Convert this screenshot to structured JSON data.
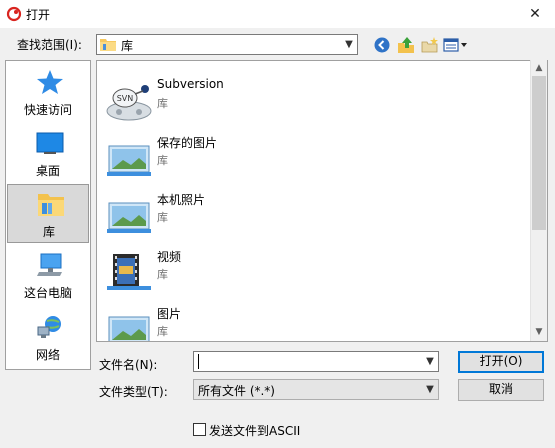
{
  "window": {
    "title": "打开",
    "close_glyph": "✕"
  },
  "toolbar": {
    "lookin_label": "查找范围(I):",
    "lookin_value": "库",
    "buttons": [
      "back-icon",
      "up-folder-icon",
      "new-folder-icon",
      "view-menu-icon"
    ]
  },
  "places": [
    {
      "label": "快速访问",
      "icon": "star-icon"
    },
    {
      "label": "桌面",
      "icon": "desktop-icon"
    },
    {
      "label": "库",
      "icon": "library-folder-icon",
      "selected": true
    },
    {
      "label": "这台电脑",
      "icon": "computer-icon"
    },
    {
      "label": "网络",
      "icon": "network-icon"
    }
  ],
  "files": [
    {
      "name": "Subversion",
      "type": "库",
      "icon": "svn-icon"
    },
    {
      "name": "保存的图片",
      "type": "库",
      "icon": "picture-library-icon"
    },
    {
      "name": "本机照片",
      "type": "库",
      "icon": "picture-library-icon"
    },
    {
      "name": "视频",
      "type": "库",
      "icon": "video-library-icon"
    },
    {
      "name": "图片",
      "type": "库",
      "icon": "picture-library-icon"
    }
  ],
  "form": {
    "filename_label": "文件名(N):",
    "filename_value": "",
    "filetype_label": "文件类型(T):",
    "filetype_value": "所有文件 (*.*)",
    "open_label": "打开(O)",
    "cancel_label": "取消",
    "ascii_label": "发送文件到ASCII",
    "ascii_checked": false
  },
  "colors": {
    "accent": "#0078d7",
    "selection": "#d9d9d9"
  }
}
